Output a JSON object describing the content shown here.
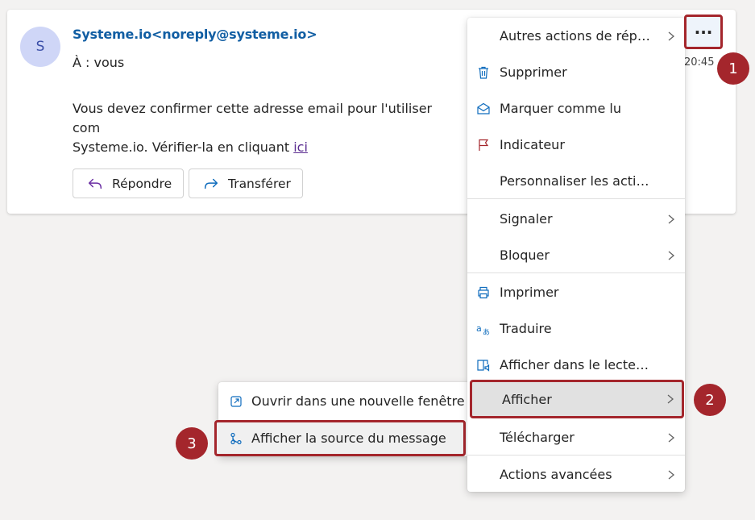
{
  "email": {
    "avatar_initial": "S",
    "sender": "Systeme.io<noreply@systeme.io>",
    "to_line": "À :  vous",
    "time": "20:45",
    "body_line1": "Vous devez confirmer cette adresse email pour l'utiliser com",
    "body_line2_prefix": "Systeme.io. Vérifier-la en cliquant ",
    "body_link": "ici",
    "reply_label": "Répondre",
    "forward_label": "Transférer"
  },
  "more_button_label": "···",
  "menu": {
    "items": [
      {
        "label": "Autres actions de répon…"
      },
      {
        "label": "Supprimer"
      },
      {
        "label": "Marquer comme lu"
      },
      {
        "label": "Indicateur"
      },
      {
        "label": "Personnaliser les actions"
      },
      {
        "label": "Signaler"
      },
      {
        "label": "Bloquer"
      },
      {
        "label": "Imprimer"
      },
      {
        "label": "Traduire"
      },
      {
        "label": "Afficher dans le lecteur i…"
      },
      {
        "label": "Afficher"
      },
      {
        "label": "Télécharger"
      },
      {
        "label": "Actions avancées"
      }
    ]
  },
  "submenu": {
    "items": [
      {
        "label": "Ouvrir dans une nouvelle fenêtre"
      },
      {
        "label": "Afficher la source du message"
      }
    ]
  },
  "badges": [
    "1",
    "2",
    "3"
  ],
  "colors": {
    "accent_red": "#a4262c",
    "link_blue": "#115ea3",
    "icon_blue": "#0f6cbd"
  }
}
